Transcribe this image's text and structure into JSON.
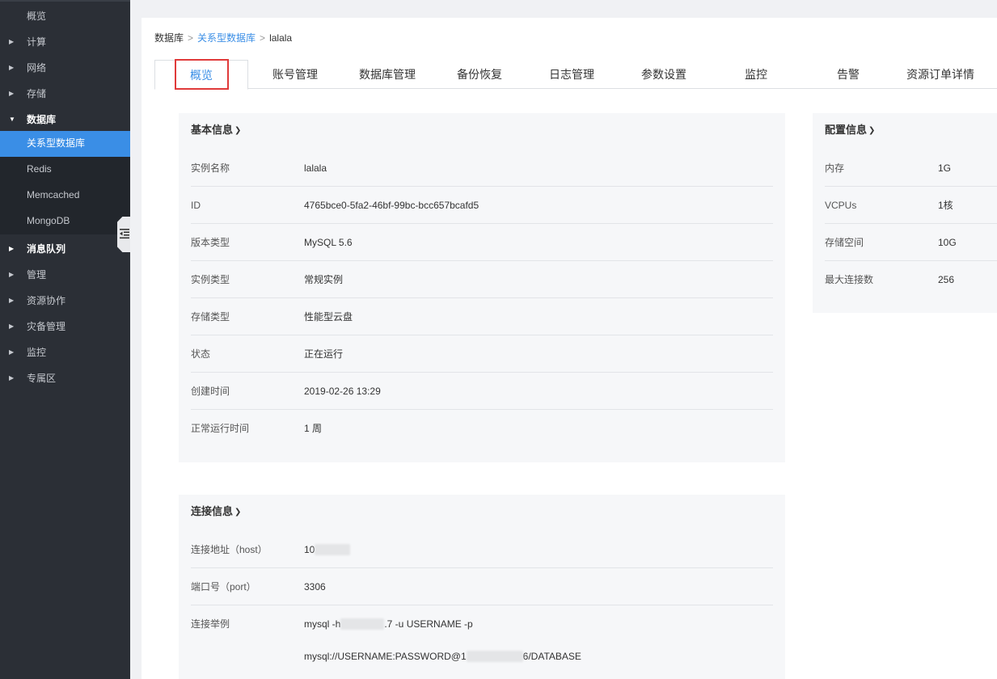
{
  "sidebar": {
    "items": [
      {
        "label": "概览"
      },
      {
        "label": "计算"
      },
      {
        "label": "网络"
      },
      {
        "label": "存储"
      },
      {
        "label": "数据库"
      },
      {
        "label": "消息队列"
      },
      {
        "label": "管理"
      },
      {
        "label": "资源协作"
      },
      {
        "label": "灾备管理"
      },
      {
        "label": "监控"
      },
      {
        "label": "专属区"
      }
    ],
    "db_subitems": [
      {
        "label": "关系型数据库"
      },
      {
        "label": "Redis"
      },
      {
        "label": "Memcached"
      },
      {
        "label": "MongoDB"
      }
    ],
    "collapse_icon": "collapse-sidebar-icon"
  },
  "breadcrumb": {
    "root": "数据库",
    "sep1": ">",
    "parent": "关系型数据库",
    "sep2": ">",
    "current": "lalala"
  },
  "tabs": [
    {
      "label": "概览"
    },
    {
      "label": "账号管理"
    },
    {
      "label": "数据库管理"
    },
    {
      "label": "备份恢复"
    },
    {
      "label": "日志管理"
    },
    {
      "label": "参数设置"
    },
    {
      "label": "监控"
    },
    {
      "label": "告警"
    },
    {
      "label": "资源订单详情"
    }
  ],
  "basic_info": {
    "title": "基本信息",
    "rows": [
      {
        "key": "实例名称",
        "value": "lalala"
      },
      {
        "key": "ID",
        "value": "4765bce0-5fa2-46bf-99bc-bcc657bcafd5"
      },
      {
        "key": "版本类型",
        "value": "MySQL 5.6"
      },
      {
        "key": "实例类型",
        "value": "常规实例"
      },
      {
        "key": "存储类型",
        "value": "性能型云盘"
      },
      {
        "key": "状态",
        "value": "正在运行"
      },
      {
        "key": "创建时间",
        "value": "2019-02-26 13:29"
      },
      {
        "key": "正常运行时间",
        "value": "1 周"
      }
    ]
  },
  "config_info": {
    "title": "配置信息",
    "rows": [
      {
        "key": "内存",
        "value": "1G"
      },
      {
        "key": "VCPUs",
        "value": "1核"
      },
      {
        "key": "存储空间",
        "value": "10G"
      },
      {
        "key": "最大连接数",
        "value": "256"
      }
    ]
  },
  "connection_info": {
    "title": "连接信息",
    "host_key": "连接地址（host）",
    "host_value": "10",
    "port_key": "端口号（port）",
    "port_value": "3306",
    "example_key": "连接举例",
    "example1_a": "mysql -h",
    "example1_b": ".7 -u USERNAME -p",
    "example2_a": "mysql://USERNAME:PASSWORD@1",
    "example2_b": "6/DATABASE"
  },
  "colors": {
    "sidebar_bg": "#2b2f36",
    "accent": "#3a8ee6",
    "highlight_box": "#e03a3a"
  }
}
